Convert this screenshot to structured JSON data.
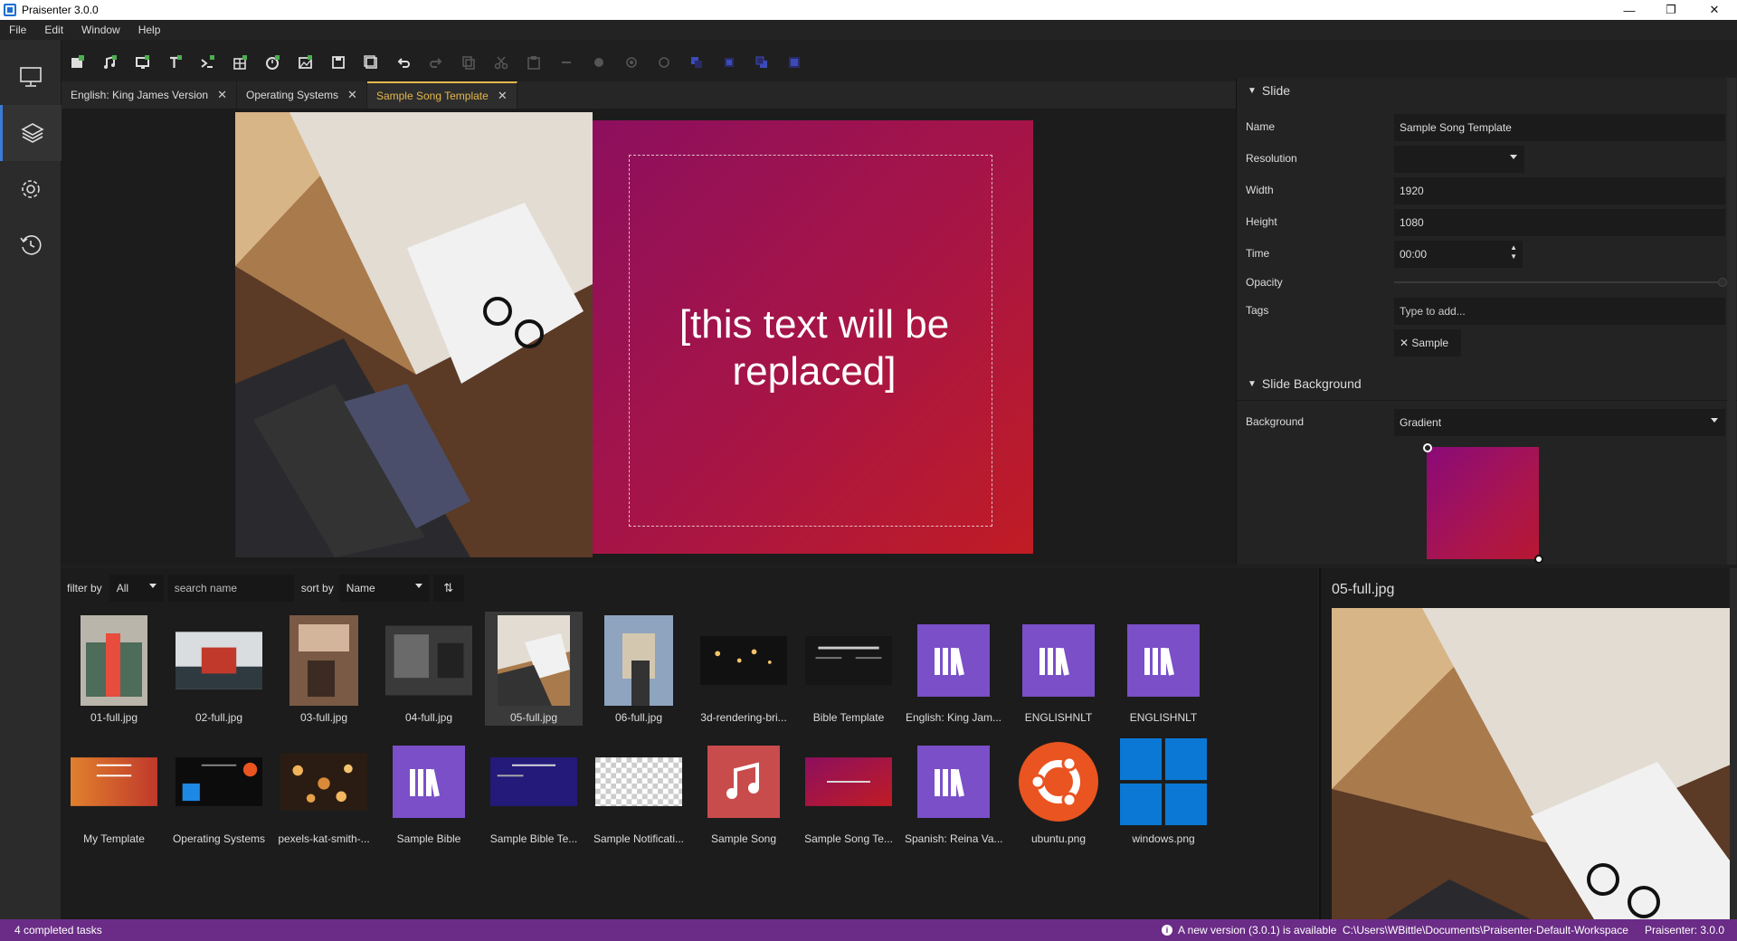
{
  "window": {
    "title": "Praisenter 3.0.0"
  },
  "menu": [
    "File",
    "Edit",
    "Window",
    "Help"
  ],
  "toolbar": {
    "icons": [
      "new-bible-icon",
      "new-song-icon",
      "new-slide-icon",
      "new-text-icon",
      "new-command-icon",
      "new-table-icon",
      "new-countdown-icon",
      "new-image-icon",
      "save-icon",
      "save-all-icon",
      "undo-icon",
      "redo-icon",
      "copy-icon",
      "cut-icon",
      "paste-icon",
      "delete-icon",
      "move-front-icon",
      "move-up-icon",
      "move-down-icon",
      "move-back-icon",
      "layer-1-icon",
      "layer-2-icon",
      "layer-3-icon",
      "layer-4-icon"
    ]
  },
  "tabs": [
    {
      "label": "English: King James Version",
      "active": false
    },
    {
      "label": "Operating Systems",
      "active": false
    },
    {
      "label": "Sample Song Template",
      "active": true
    }
  ],
  "slide": {
    "text": "[this text will be replaced]"
  },
  "props": {
    "slide_section": "Slide",
    "name_label": "Name",
    "name_value": "Sample Song Template",
    "resolution_label": "Resolution",
    "resolution_value": "",
    "width_label": "Width",
    "width_value": "1920",
    "height_label": "Height",
    "height_value": "1080",
    "time_label": "Time",
    "time_value": "00:00",
    "opacity_label": "Opacity",
    "opacity_value": 1.0,
    "tags_label": "Tags",
    "tags_placeholder": "Type to add...",
    "tag_chip": "✕ Sample",
    "bg_section": "Slide Background",
    "background_label": "Background",
    "background_value": "Gradient"
  },
  "browser": {
    "filter_label": "filter by",
    "filter_value": "All",
    "search_placeholder": "search name",
    "sort_label": "sort by",
    "sort_value": "Name",
    "items": [
      "01-full.jpg",
      "02-full.jpg",
      "03-full.jpg",
      "04-full.jpg",
      "05-full.jpg",
      "06-full.jpg",
      "3d-rendering-bri...",
      "Bible Template",
      "English: King Jam...",
      "ENGLISHNLT",
      "ENGLISHNLT",
      "My Template",
      "Operating Systems",
      "pexels-kat-smith-...",
      "Sample Bible",
      "Sample Bible Te...",
      "Sample Notificati...",
      "Sample Song",
      "Sample Song Te...",
      "Spanish: Reina Va...",
      "ubuntu.png",
      "windows.png"
    ],
    "selected": "05-full.jpg"
  },
  "preview": {
    "title": "05-full.jpg"
  },
  "status": {
    "tasks": "4 completed tasks",
    "update": "A new version (3.0.1) is available",
    "path": "C:\\Users\\WBittle\\Documents\\Praisenter-Default-Workspace",
    "app": "Praisenter: 3.0.0"
  },
  "colors": {
    "accent": "#e5b84a",
    "status_bar": "#6a2c86",
    "library_icon": "#7a4fc8",
    "active_sidebar": "#3a7bd5"
  }
}
